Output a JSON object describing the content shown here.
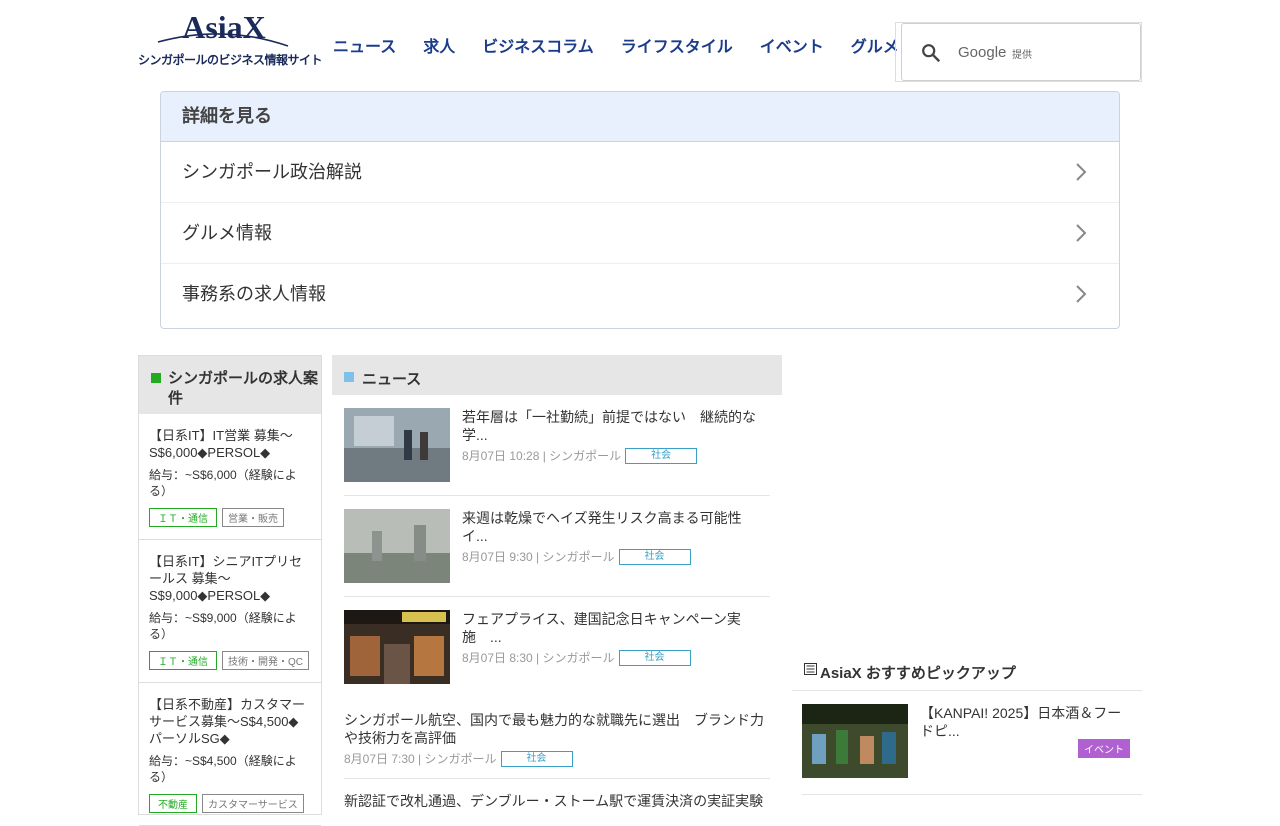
{
  "header": {
    "logo_text": "AsiaX",
    "tagline": "シンガポールのビジネス情報サイト",
    "nav": [
      "ニュース",
      "求人",
      "ビジネスコラム",
      "ライフスタイル",
      "イベント",
      "グルメ"
    ],
    "search_google": "Google",
    "search_provided": "提供"
  },
  "details": {
    "heading": "詳細を見る",
    "items": [
      "シンガポール政治解説",
      "グルメ情報",
      "事務系の求人情報"
    ]
  },
  "jobs": {
    "heading": "シンガポールの求人案件",
    "items": [
      {
        "title": "【日系IT】IT営業 募集～S$6,000◆PERSOL◆",
        "salary": "給与：~S$6,000（経験による）",
        "tags": [
          "ＩＴ・通信",
          "営業・販売"
        ]
      },
      {
        "title": "【日系IT】シニアITプリセールス 募集～S$9,000◆PERSOL◆",
        "salary": "給与：~S$9,000（経験による）",
        "tags": [
          "ＩＴ・通信",
          "技術・開発・QC"
        ]
      },
      {
        "title": "【日系不動産】カスタマーサービス募集～S$4,500◆パーソルSG◆",
        "salary": "給与：~S$4,500（経験による）",
        "tags": [
          "不動産",
          "カスタマーサービス"
        ]
      }
    ]
  },
  "news": {
    "heading": "ニュース",
    "items": [
      {
        "title": "若年層は「一社勤続」前提ではない　継続的な学...",
        "meta": "8月07日 10:28 | シンガポール",
        "cat": "社会"
      },
      {
        "title": "来週は乾燥でヘイズ発生リスク高まる可能性イ...",
        "meta": "8月07日 9:30 | シンガポール",
        "cat": "社会"
      },
      {
        "title": "フェアプライス、建国記念日キャンペーン実施　...",
        "meta": "8月07日 8:30 | シンガポール",
        "cat": "社会"
      },
      {
        "title": "シンガポール航空、国内で最も魅力的な就職先に選出　ブランド力や技術力を高評価",
        "meta": "8月07日 7:30 | シンガポール",
        "cat": "社会"
      },
      {
        "title": "新認証で改札通過、デンブルー・ストーム駅で運賃決済の実証実験",
        "meta": "",
        "cat": ""
      }
    ]
  },
  "pickup": {
    "heading": "AsiaX おすすめピックアップ",
    "items": [
      {
        "title": "【KANPAI! 2025】日本酒＆フードピ...",
        "tag": "イベント"
      }
    ]
  }
}
